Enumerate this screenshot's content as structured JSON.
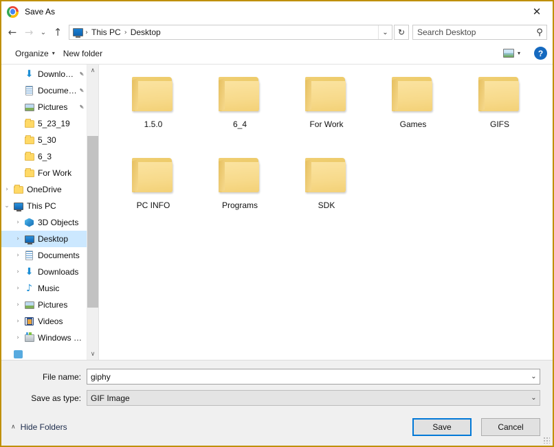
{
  "window": {
    "title": "Save As",
    "app_icon": "chrome-icon",
    "close_label": "✕",
    "accent_border": "#bf9000"
  },
  "nav": {
    "back": "←",
    "forward": "→",
    "recent": "⌄",
    "up": "↑",
    "refresh": "↻",
    "dropdown": "⌄",
    "breadcrumbs": [
      {
        "label": "This PC"
      },
      {
        "label": "Desktop"
      }
    ],
    "separator": "›"
  },
  "search": {
    "placeholder": "Search Desktop",
    "value": "",
    "icon": "⚲"
  },
  "toolbar": {
    "organize_label": "Organize",
    "new_folder_label": "New folder",
    "caret": "▾",
    "help_label": "?"
  },
  "sidebar": {
    "items": [
      {
        "label": "Downloads",
        "icon": "download-icon",
        "expander": "",
        "indent": 1,
        "pinned": true,
        "selected": false
      },
      {
        "label": "Documents",
        "icon": "document-icon",
        "expander": "",
        "indent": 1,
        "pinned": true,
        "selected": false
      },
      {
        "label": "Pictures",
        "icon": "picture-icon",
        "expander": "",
        "indent": 1,
        "pinned": true,
        "selected": false
      },
      {
        "label": "5_23_19",
        "icon": "folder-icon",
        "expander": "",
        "indent": 1,
        "pinned": false,
        "selected": false
      },
      {
        "label": "5_30",
        "icon": "folder-icon",
        "expander": "",
        "indent": 1,
        "pinned": false,
        "selected": false
      },
      {
        "label": "6_3",
        "icon": "folder-icon",
        "expander": "",
        "indent": 1,
        "pinned": false,
        "selected": false
      },
      {
        "label": "For Work",
        "icon": "folder-icon",
        "expander": "",
        "indent": 1,
        "pinned": false,
        "selected": false
      },
      {
        "label": "OneDrive",
        "icon": "folder-icon",
        "expander": "›",
        "indent": 0,
        "pinned": false,
        "selected": false
      },
      {
        "label": "This PC",
        "icon": "monitor-icon",
        "expander": "⌄",
        "indent": 0,
        "pinned": false,
        "selected": false
      },
      {
        "label": "3D Objects",
        "icon": "3d-objects-icon",
        "expander": "›",
        "indent": 1,
        "pinned": false,
        "selected": false
      },
      {
        "label": "Desktop",
        "icon": "monitor-icon",
        "expander": "›",
        "indent": 1,
        "pinned": false,
        "selected": true
      },
      {
        "label": "Documents",
        "icon": "document-icon",
        "expander": "›",
        "indent": 1,
        "pinned": false,
        "selected": false
      },
      {
        "label": "Downloads",
        "icon": "download-icon",
        "expander": "›",
        "indent": 1,
        "pinned": false,
        "selected": false
      },
      {
        "label": "Music",
        "icon": "music-icon",
        "expander": "›",
        "indent": 1,
        "pinned": false,
        "selected": false
      },
      {
        "label": "Pictures",
        "icon": "picture-icon",
        "expander": "›",
        "indent": 1,
        "pinned": false,
        "selected": false
      },
      {
        "label": "Videos",
        "icon": "video-icon",
        "expander": "›",
        "indent": 1,
        "pinned": false,
        "selected": false
      },
      {
        "label": "Windows (C:)",
        "icon": "drive-icon",
        "expander": "›",
        "indent": 1,
        "pinned": false,
        "selected": false
      },
      {
        "label": "",
        "icon": "network-icon",
        "expander": "",
        "indent": 0,
        "pinned": false,
        "selected": false
      }
    ],
    "scroll_up": "∧",
    "scroll_down": "∨"
  },
  "files": [
    {
      "name": "1.5.0",
      "type": "folder"
    },
    {
      "name": "6_4",
      "type": "folder"
    },
    {
      "name": "For Work",
      "type": "folder"
    },
    {
      "name": "Games",
      "type": "folder"
    },
    {
      "name": "GIFS",
      "type": "folder"
    },
    {
      "name": "PC INFO",
      "type": "folder"
    },
    {
      "name": "Programs",
      "type": "folder"
    },
    {
      "name": "SDK",
      "type": "folder"
    }
  ],
  "form": {
    "file_name_label": "File name:",
    "file_name_value": "giphy",
    "save_as_type_label": "Save as type:",
    "save_as_type_value": "GIF Image",
    "combo_arrow": "⌄"
  },
  "footer": {
    "hide_folders_label": "Hide Folders",
    "hide_folders_chevron": "∧",
    "save_label": "Save",
    "cancel_label": "Cancel",
    "default_button_color": "#0078d7"
  }
}
